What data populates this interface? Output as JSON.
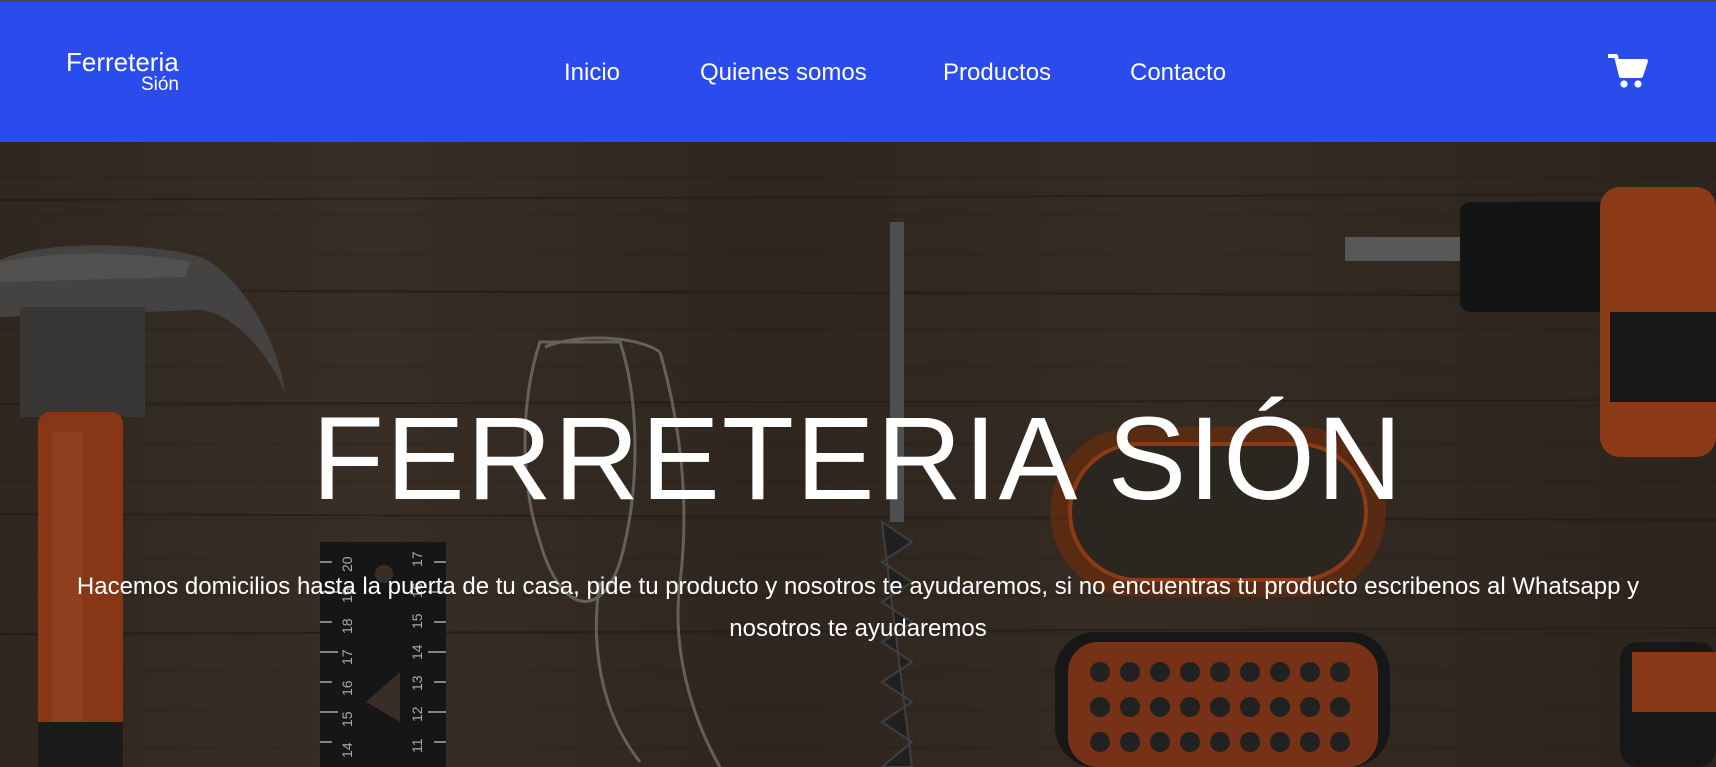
{
  "nav": {
    "brand_name": "Ferreteria",
    "brand_sub": "Sión",
    "items": [
      {
        "label": "Inicio"
      },
      {
        "label": "Quienes somos"
      },
      {
        "label": "Productos"
      },
      {
        "label": "Contacto"
      }
    ],
    "cart_icon": "shopping-cart-icon",
    "background": "#2a4ced"
  },
  "hero": {
    "title": "FERRETERIA SIÓN",
    "description": "Hacemos domicilios hasta la puerta de tu casa, pide tu producto y nosotros te ayudaremos, si no encuentras tu producto escribenos al Whatsapp y nosotros te ayudaremos",
    "ruler_numbers": [
      "20",
      "19",
      "18",
      "17",
      "16",
      "15",
      "14",
      "17",
      "16",
      "15",
      "14",
      "13",
      "12",
      "11"
    ]
  }
}
